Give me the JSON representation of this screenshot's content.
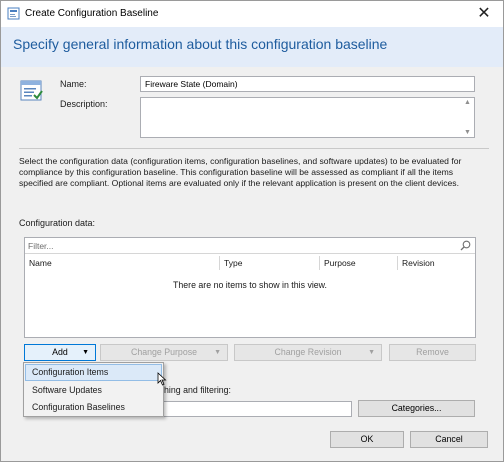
{
  "window": {
    "title": "Create Configuration Baseline",
    "close_glyph": "✕"
  },
  "header": {
    "text": "Specify general information about this configuration baseline"
  },
  "form": {
    "name_label": "Name:",
    "name_value": "Fireware State (Domain)",
    "description_label": "Description:",
    "description_value": ""
  },
  "instructions": "Select the configuration data (configuration items, configuration baselines, and software updates) to be evaluated for compliance by this configuration baseline. This configuration baseline will be assessed as compliant if all the items specified are compliant. Optional items are evaluated only if the relevant application is present on  the client devices.",
  "config_data": {
    "label": "Configuration data:",
    "filter_placeholder": "Filter...",
    "columns": [
      "Name",
      "Type",
      "Purpose",
      "Revision"
    ],
    "empty_message": "There are no items to show in this view."
  },
  "buttons": {
    "add": "Add",
    "change_purpose": "Change Purpose",
    "change_revision": "Change Revision",
    "remove": "Remove",
    "categories": "Categories...",
    "ok": "OK",
    "cancel": "Cancel"
  },
  "add_menu": {
    "items": [
      "Configuration Items",
      "Software Updates",
      "Configuration Baselines"
    ],
    "highlighted": "Configuration Items"
  },
  "search_section": {
    "label_fragment": "hing and filtering:"
  },
  "colors": {
    "accent": "#1e5c9e",
    "header_band": "#e3ecf9",
    "panel": "#f0f0f0"
  }
}
